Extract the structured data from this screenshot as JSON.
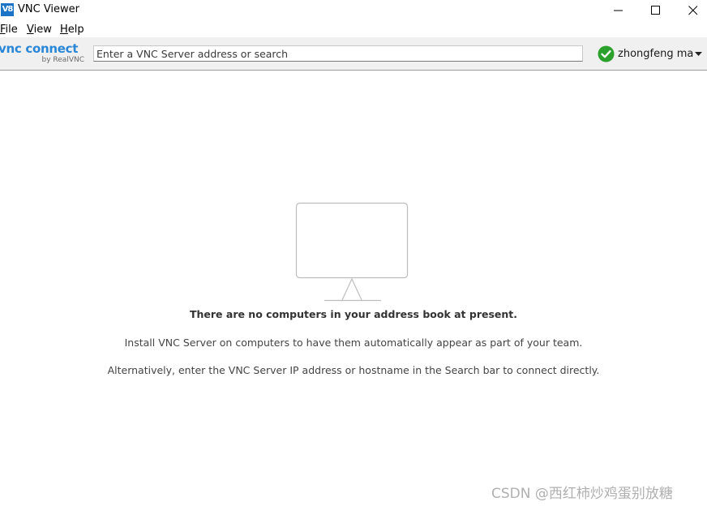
{
  "window": {
    "icon_text": "V8",
    "title": "VNC Viewer"
  },
  "menu": {
    "file": {
      "accel": "F",
      "rest": "ile"
    },
    "view": {
      "accel": "V",
      "rest": "iew"
    },
    "help": {
      "accel": "H",
      "rest": "elp"
    }
  },
  "toolbar": {
    "logo_main": "vnc connect",
    "logo_sub": "by RealVNC",
    "search_placeholder": "Enter a VNC Server address or search",
    "user_name": "zhongfeng ma",
    "status_color": "#2ca02c",
    "brand_color": "#2a86d6"
  },
  "empty_state": {
    "icon": "monitor-icon",
    "heading": "There are no computers in your address book at present.",
    "line1": "Install VNC Server on computers to have them automatically appear as part of your team.",
    "line2": "Alternatively, enter the VNC Server IP address or hostname in the Search bar to connect directly."
  },
  "watermark": "CSDN @西红柿炒鸡蛋别放糖"
}
